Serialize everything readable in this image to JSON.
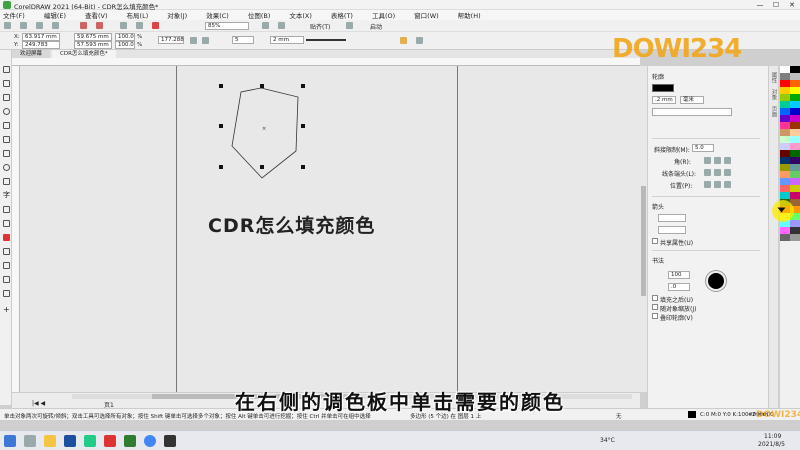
{
  "window": {
    "title": "CorelDRAW 2021 (64-Bit) - CDR怎么填充颜色*",
    "controls": [
      "—",
      "☐",
      "✕"
    ]
  },
  "menu": [
    "文件(F)",
    "编辑(E)",
    "查看(V)",
    "布局(L)",
    "对象(J)",
    "效果(C)",
    "位图(B)",
    "文本(X)",
    "表格(T)",
    "工具(O)",
    "窗口(W)",
    "帮助(H)"
  ],
  "toolbar": {
    "zoom": "85%",
    "snap_label": "贴齐(T)",
    "launch_label": "启动"
  },
  "propbar": {
    "x_label": "X:",
    "x": "63.917 mm",
    "y_label": "Y:",
    "y": "249.783 mm",
    "w": "59.675 mm",
    "h": "57.593 mm",
    "sx": "100.0",
    "sy": "100.0",
    "pct": "%",
    "angle": "177.288",
    "sides": "5",
    "outline": "2 mm"
  },
  "tabs": [
    "欢迎屏幕",
    "CDR怎么填充颜色*"
  ],
  "canvas": {
    "heading": "CDR怎么填充颜色"
  },
  "page_nav": {
    "page": "页1"
  },
  "panel": {
    "title": "轮廓",
    "width_value": ".2 mm",
    "unit": "毫米",
    "miter_label": "斜接限制(M):",
    "miter_value": "5.0",
    "corner_label": "角(R):",
    "caps_label": "线条端头(L):",
    "position_label": "位置(P):",
    "arrows_title": "箭头",
    "shared_attr": "共享属性(U)",
    "calligraphy_title": "书法",
    "stretch_value": "100",
    "angle_value": ".0",
    "opt1": "填充之后(U)",
    "opt2": "随对象缩放(J)",
    "opt3": "叠印轮廓(V)"
  },
  "docker_tabs": [
    "属性",
    "对象",
    "页面"
  ],
  "status": {
    "left": "单击对象两次可旋转/倾斜；双击工具可选择所有对象；按住 Shift 键单击可选择多个对象；按住 Alt 键单击可进行挖掘；按住 Ctrl 并单击可在组中选择",
    "middle": "多边形 (5 个边) 在 图层 1 上",
    "fill": "无",
    "outline": "C:0 M:0 Y:0 K:100 .2 mm",
    "color_code": "#000000"
  },
  "taskbar": {
    "temp": "34°C",
    "time": "11:09",
    "date": "2021/8/5"
  },
  "caption": "在右侧的调色板中单击需要的颜色",
  "watermark": "DOWI234",
  "colors": {
    "accent": "#f1a61b",
    "ink": "#222222"
  },
  "palette_colors": [
    "#ffffff",
    "#000000",
    "#7f7f7f",
    "#bfbfbf",
    "#ff0000",
    "#ff6600",
    "#ffcc00",
    "#ffff00",
    "#99cc00",
    "#00aa00",
    "#00cc99",
    "#00ccff",
    "#0066ff",
    "#0000cc",
    "#6600cc",
    "#cc00cc",
    "#ff3399",
    "#993300",
    "#cc9966",
    "#ffcc99",
    "#ccffcc",
    "#99ffff",
    "#ccccff",
    "#ff99cc",
    "#660000",
    "#006600",
    "#003366",
    "#330066",
    "#999900",
    "#669999",
    "#ff9966",
    "#66cc66",
    "#6699ff",
    "#cc66ff",
    "#ff6666",
    "#cccc00",
    "#00cccc",
    "#cc0066",
    "#336600",
    "#996633",
    "#ff0000",
    "#ff9900",
    "#ffff66",
    "#66ff66",
    "#66ffff",
    "#9999ff",
    "#ff66ff",
    "#333333",
    "#666666",
    "#999999"
  ]
}
